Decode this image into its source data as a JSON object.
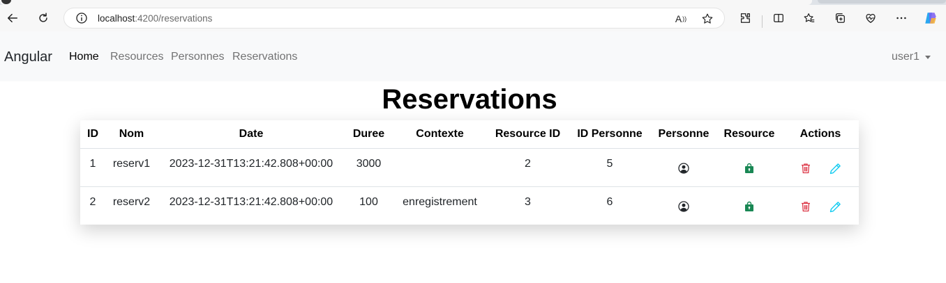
{
  "browser": {
    "url_host": "localhost",
    "url_path": ":4200/reservations",
    "read_aloud_label": "A",
    "icons": [
      "back-arrow-icon",
      "refresh-icon",
      "info-icon",
      "read-aloud-icon",
      "favorite-star-icon",
      "extensions-icon",
      "split-screen-icon",
      "favorites-icon",
      "collections-icon",
      "performance-icon",
      "more-icon",
      "copilot-icon"
    ]
  },
  "navbar": {
    "brand": "Angular",
    "links": [
      {
        "label": "Home",
        "active": true
      },
      {
        "label": "Resources",
        "active": false
      },
      {
        "label": "Personnes",
        "active": false
      },
      {
        "label": "Reservations",
        "active": false
      }
    ],
    "user": "user1"
  },
  "page": {
    "title": "Reservations"
  },
  "table": {
    "headers": {
      "id": "ID",
      "nom": "Nom",
      "date": "Date",
      "duree": "Duree",
      "contexte": "Contexte",
      "resource_id": "Resource ID",
      "id_personne": "ID Personne",
      "personne": "Personne",
      "resource": "Resource",
      "actions": "Actions"
    },
    "rows": [
      {
        "id": "1",
        "nom": "reserv1",
        "date": "2023-12-31T13:21:42.808+00:00",
        "duree": "3000",
        "contexte": "",
        "resource_id": "2",
        "id_personne": "5"
      },
      {
        "id": "2",
        "nom": "reserv2",
        "date": "2023-12-31T13:21:42.808+00:00",
        "duree": "100",
        "contexte": "enregistrement",
        "resource_id": "3",
        "id_personne": "6"
      }
    ],
    "icons": {
      "personne": "person-circle-icon",
      "resource": "lock-bag-icon",
      "delete": "trash-icon",
      "edit": "pencil-icon"
    },
    "colors": {
      "delete": "#dc3545",
      "edit": "#0dcaf0",
      "resource": "#198754"
    }
  }
}
